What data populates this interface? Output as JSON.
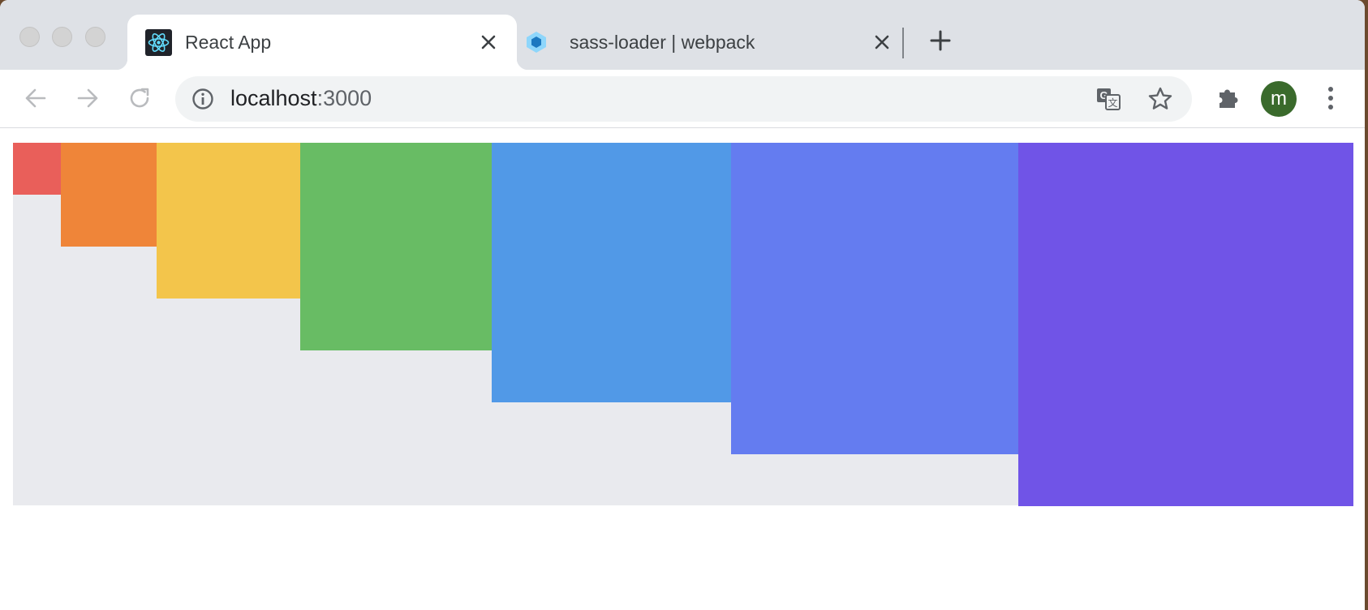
{
  "browser": {
    "tabs": [
      {
        "title": "React App",
        "favicon": "react-logo-icon",
        "active": true
      },
      {
        "title": "sass-loader | webpack",
        "favicon": "webpack-logo-icon",
        "active": false
      }
    ],
    "address": {
      "host": "localhost",
      "port": ":3000"
    },
    "profile_initial": "m",
    "icons": [
      "back-arrow-icon",
      "forward-arrow-icon",
      "reload-icon",
      "info-icon",
      "translate-icon",
      "star-icon",
      "puzzle-extension-icon",
      "more-menu-icon",
      "close-icon",
      "plus-icon"
    ]
  },
  "page": {
    "blocks": [
      {
        "color": "#e95f5a",
        "level": 1
      },
      {
        "color": "#ef8539",
        "level": 2
      },
      {
        "color": "#f3c54b",
        "level": 3
      },
      {
        "color": "#68bc64",
        "level": 4
      },
      {
        "color": "#5199e7",
        "level": 5
      },
      {
        "color": "#647cf0",
        "level": 6
      },
      {
        "color": "#7054e7",
        "level": 7
      }
    ],
    "container_color": "#e9eaee"
  }
}
